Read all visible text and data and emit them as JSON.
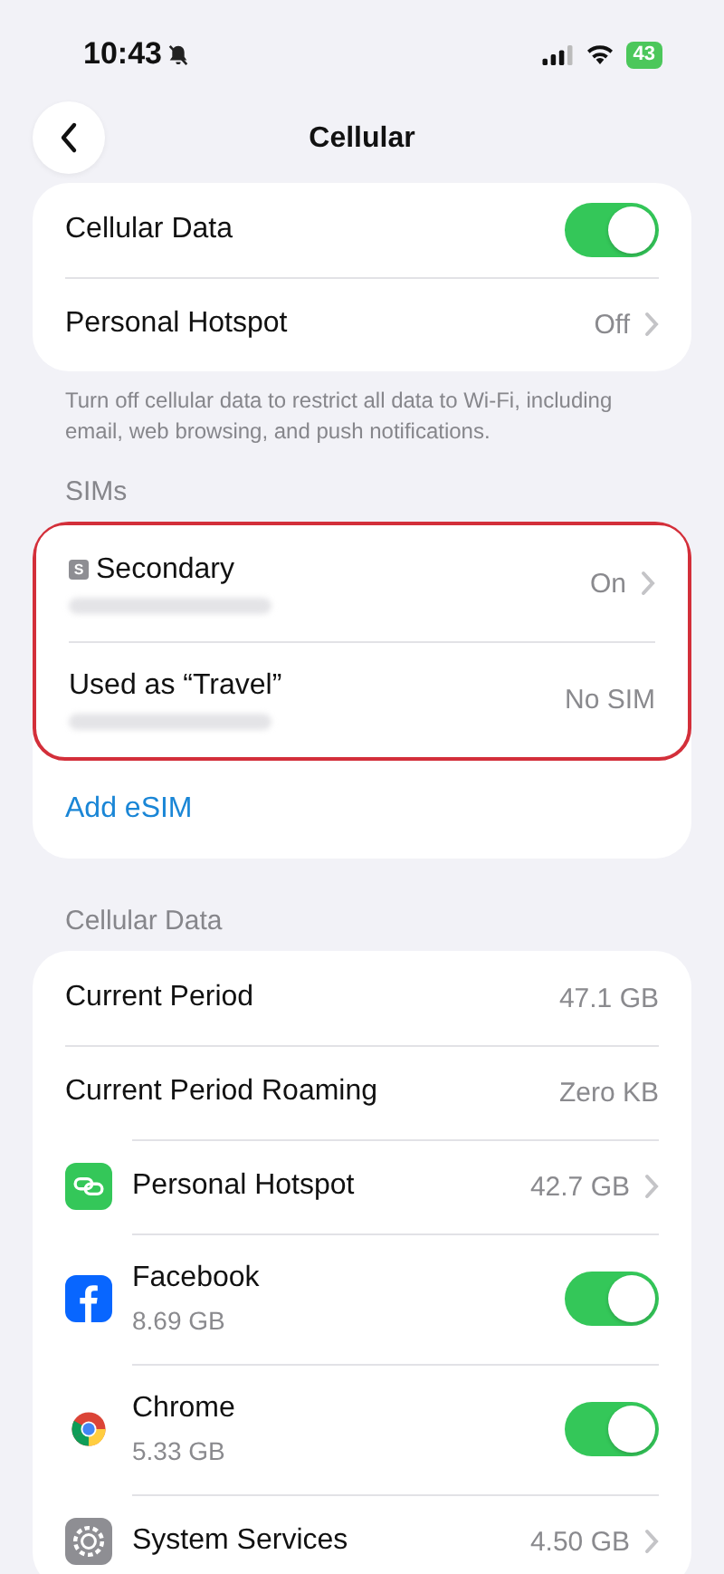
{
  "status_bar": {
    "time": "10:43",
    "silent": true,
    "battery": "43",
    "charging": true
  },
  "nav": {
    "title": "Cellular"
  },
  "main_rows": [
    {
      "kind": "toggle",
      "label": "Cellular Data",
      "on": true
    },
    {
      "kind": "value",
      "label": "Personal Hotspot",
      "value": "Off",
      "chevron": true
    }
  ],
  "main_footer": "Turn off cellular data to restrict all data to Wi-Fi, including email, web browsing, and push notifications.",
  "sims": {
    "header": "SIMs",
    "highlighted": true,
    "rows": [
      {
        "badge": "S",
        "label": "Secondary",
        "value": "On",
        "chevron": true
      },
      {
        "label": "Used as “Travel”",
        "value": "No SIM",
        "chevron": false
      }
    ],
    "action": "Add eSIM"
  },
  "usage": {
    "header": "Cellular Data",
    "rows": [
      {
        "kind": "value",
        "label": "Current Period",
        "value": "47.1 GB",
        "chevron": false
      },
      {
        "kind": "value",
        "label": "Current Period Roaming",
        "value": "Zero KB",
        "chevron": false
      },
      {
        "kind": "value",
        "label": "Personal Hotspot",
        "value": "42.7 GB",
        "chevron": true
      },
      {
        "kind": "toggle",
        "label": "Facebook",
        "sub": "8.69 GB",
        "on": true
      },
      {
        "kind": "toggle",
        "label": "Chrome",
        "sub": "5.33 GB",
        "on": true
      },
      {
        "kind": "value",
        "label": "System Services",
        "value": "4.50 GB",
        "chevron": true
      }
    ]
  }
}
